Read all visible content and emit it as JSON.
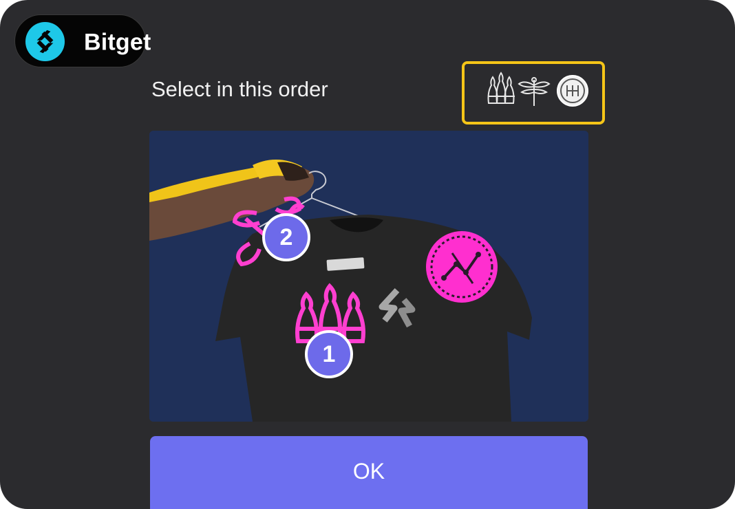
{
  "brand": {
    "name": "Bitget",
    "logo_color": "#1ec8e8"
  },
  "captcha": {
    "prompt": "Select in this order",
    "order_icons": [
      "bowling-pins-icon",
      "dragonfly-icon",
      "circuit-button-icon"
    ],
    "highlight_color": "#f5c518",
    "target_color": "#ff3fd0",
    "selections": [
      {
        "label": "1",
        "target": "bowling-pins-icon"
      },
      {
        "label": "2",
        "target": "dragonfly-icon"
      }
    ]
  },
  "actions": {
    "ok_label": "OK",
    "ok_color": "#6d6ff0"
  }
}
